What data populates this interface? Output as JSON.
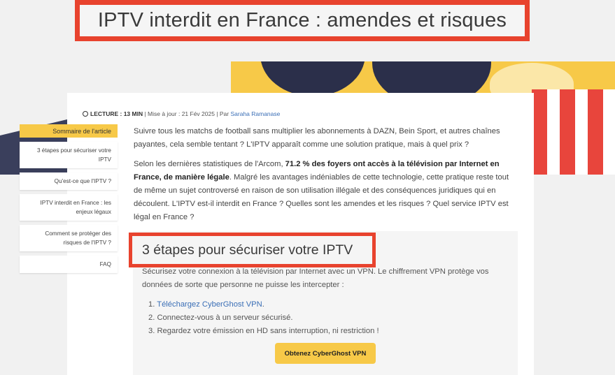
{
  "page": {
    "title": "IPTV interdit en France : amendes et risques"
  },
  "meta": {
    "reading_label": "LECTURE : 13 MIN",
    "update_text": "| Mise à jour : 21 Fév 2025 | Par",
    "author": "Saraha Ramanase"
  },
  "toc": {
    "header": "Sommaire de l'article",
    "items": [
      {
        "label": "3 étapes pour sécuriser votre IPTV"
      },
      {
        "label": "Qu'est-ce que l'IPTV ?"
      },
      {
        "label": "IPTV interdit en France : les enjeux légaux"
      },
      {
        "label": "Comment se protéger des risques de l'IPTV ?"
      },
      {
        "label": "FAQ"
      }
    ]
  },
  "article": {
    "intro": "Suivre tous les matchs de football sans multiplier les abonnements à DAZN, Bein Sport, et autres chaînes payantes, cela semble tentant ? L'IPTV apparaît comme une solution pratique, mais à quel prix ?",
    "stats_lead": "Selon les dernières statistiques de l'Arcom,",
    "stats_bold": "71.2 % des foyers ont accès à la télévision par Internet en France, de manière légale",
    "stats_rest": ". Malgré les avantages indéniables de cette technologie, cette pratique reste tout de même un sujet controversé en raison de son utilisation illégale et des conséquences juridiques qui en découlent. L'IPTV est-il interdit en France ? Quelles sont les amendes et les risques ? Quel service IPTV est légal en France ?"
  },
  "section": {
    "heading": "3 étapes pour sécuriser votre IPTV",
    "text": "Sécurisez votre connexion à la télévision par Internet avec un VPN. Le chiffrement VPN protège vos données de sorte que personne ne puisse les intercepter :",
    "steps": [
      {
        "num": "1.",
        "text": "Téléchargez CyberGhost VPN",
        "suffix": "."
      },
      {
        "num": "2.",
        "text": "Connectez-vous à un serveur sécurisé."
      },
      {
        "num": "3.",
        "text": "Regardez votre émission en HD sans interruption, ni restriction !"
      }
    ],
    "cta_label": "Obtenez CyberGhost VPN"
  },
  "colors": {
    "accent_red": "#e8432e",
    "accent_yellow": "#f7c948",
    "link_blue": "#3b6fb6"
  }
}
